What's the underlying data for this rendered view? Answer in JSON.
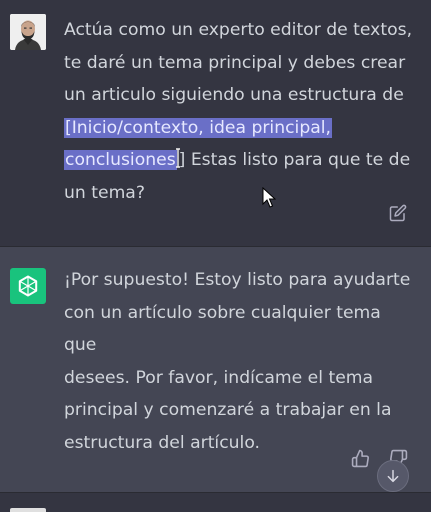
{
  "user_message": {
    "avatar": "user-photo-avatar",
    "line1": "Actúa como un experto editor de textos,",
    "line2": "te daré un tema principal y debes crear",
    "line3": "un articulo siguiendo una estructura de",
    "highlight1": "[Inicio/contexto, idea principal,",
    "highlight2": "conclusiones",
    "after_highlight": "] Estas listo para que te de",
    "line6": "un tema?",
    "edit_icon": "edit-icon"
  },
  "assistant_message": {
    "avatar": "openai-logo",
    "line1": "¡Por supuesto! Estoy listo para ayudarte",
    "line2": "con un artículo sobre cualquier tema que",
    "line3": "desees. Por favor, indícame el tema",
    "line4": "principal y comenzaré a trabajar en la",
    "line5": "estructura del artículo.",
    "like_icon": "thumbs-up-icon",
    "dislike_icon": "thumbs-down-icon"
  },
  "scroll_down_icon": "arrow-down-icon",
  "colors": {
    "background": "#343541",
    "assistant_bg": "#444654",
    "text": "#d1d5db",
    "highlight": "#6a6fc7",
    "brand_green": "#19c37d"
  }
}
